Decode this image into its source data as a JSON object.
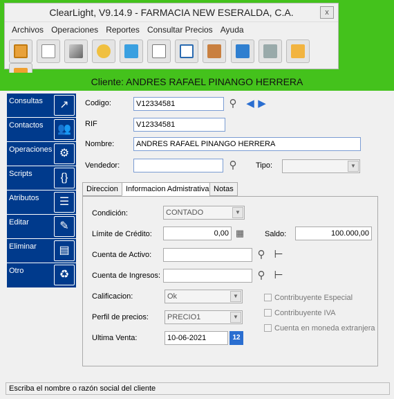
{
  "window": {
    "title": "ClearLight, V9.14.9 - FARMACIA NEW ESERALDA, C.A.",
    "close": "x"
  },
  "menu": [
    "Archivos",
    "Operaciones",
    "Reportes",
    "Consultar Precios",
    "Ayuda"
  ],
  "toolbar_icons": [
    "grid-icon",
    "table-icon",
    "pen-icon",
    "coins-icon",
    "money-icon",
    "document-icon",
    "checklist-icon",
    "dolly-icon",
    "bank-icon",
    "cash-register-icon",
    "envelope-icon",
    "folder-tree-icon"
  ],
  "header": {
    "title": "Cliente: ANDRES RAFAEL PINANGO HERRERA"
  },
  "sidebar": [
    {
      "label": "Consultas",
      "icon": "chart-icon"
    },
    {
      "label": "Contactos",
      "icon": "people-icon"
    },
    {
      "label": "Operaciones",
      "icon": "network-icon"
    },
    {
      "label": "Scripts",
      "icon": "code-icon"
    },
    {
      "label": "Atributos",
      "icon": "document-list-icon"
    },
    {
      "label": "Editar",
      "icon": "edit-icon"
    },
    {
      "label": "Eliminar",
      "icon": "shredder-icon"
    },
    {
      "label": "Otro",
      "icon": "recycle-icon"
    }
  ],
  "form": {
    "codigo_label": "Codigo:",
    "codigo": "V12334581",
    "rif_label": "RIF",
    "rif": "V12334581",
    "nombre_label": "Nombre:",
    "nombre": "ANDRES RAFAEL PINANGO HERRERA",
    "vendedor_label": "Vendedor:",
    "vendedor": "",
    "tipo_label": "Tipo:",
    "tipo": ""
  },
  "tabs": [
    "Direccion",
    "Informacion Admistrativa",
    "Notas"
  ],
  "admin": {
    "condicion_label": "Condición:",
    "condicion": "CONTADO",
    "limite_label": "Límite de Crédito:",
    "limite": "0,00",
    "saldo_label": "Saldo:",
    "saldo": "100.000,00",
    "activo_label": "Cuenta de Activo:",
    "activo": "",
    "ingresos_label": "Cuenta de Ingresos:",
    "ingresos": "",
    "calificacion_label": "Calificacion:",
    "calificacion": "Ok",
    "perfil_label": "Perfil de precios:",
    "perfil": "PRECIO1",
    "ultima_label": "Ultima Venta:",
    "ultima": "10-06-2021",
    "calendar_day": "12",
    "checks": [
      "Contribuyente Especial",
      "Contribuyente IVA",
      "Cuenta en moneda extranjera"
    ]
  },
  "status": "Escriba el nombre o razón social del cliente"
}
